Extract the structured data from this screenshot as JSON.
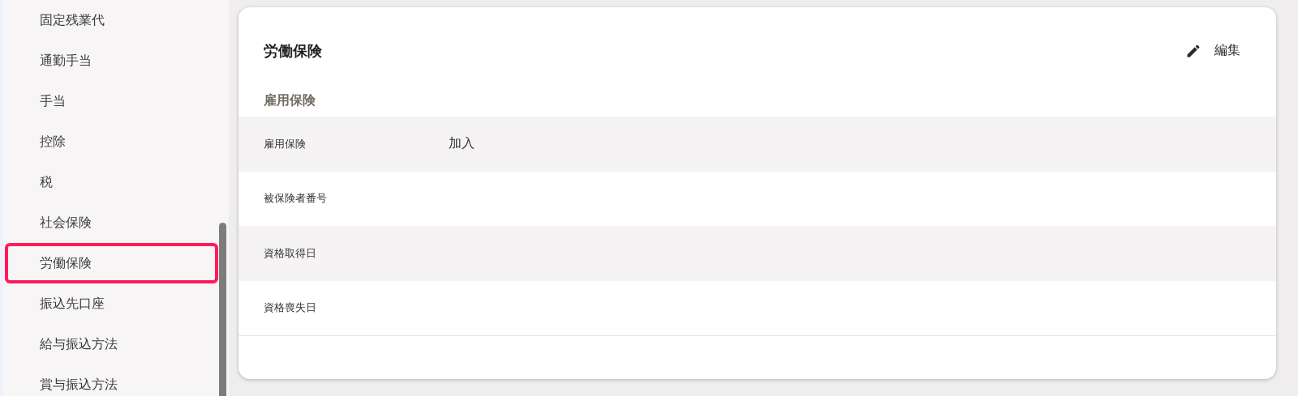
{
  "sidebar": {
    "items": [
      {
        "label": "固定残業代",
        "selected": false
      },
      {
        "label": "通勤手当",
        "selected": false
      },
      {
        "label": "手当",
        "selected": false
      },
      {
        "label": "控除",
        "selected": false
      },
      {
        "label": "税",
        "selected": false
      },
      {
        "label": "社会保険",
        "selected": false
      },
      {
        "label": "労働保険",
        "selected": true
      },
      {
        "label": "振込先口座",
        "selected": false
      },
      {
        "label": "給与振込方法",
        "selected": false
      },
      {
        "label": "賞与振込方法",
        "selected": false
      }
    ]
  },
  "card": {
    "title": "労働保険",
    "edit_button": "編集",
    "section": "雇用保険",
    "rows": [
      {
        "label": "雇用保険",
        "value": "加入"
      },
      {
        "label": "被保険者番号"
      },
      {
        "label": "資格取得日"
      },
      {
        "label": "資格喪失日"
      }
    ]
  }
}
